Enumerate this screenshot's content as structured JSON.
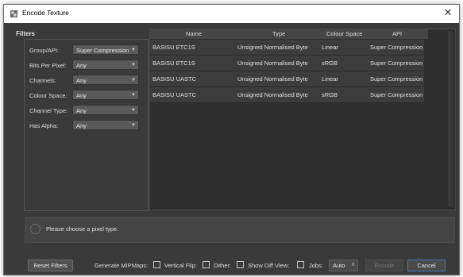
{
  "window": {
    "title": "Encode Texture",
    "close_glyph": "✕"
  },
  "filters": {
    "title": "Filters",
    "rows": [
      {
        "label": "Group/API:",
        "value": "Super Compression"
      },
      {
        "label": "Bits Per Pixel:",
        "value": "Any"
      },
      {
        "label": "Channels:",
        "value": "Any"
      },
      {
        "label": "Colour Space:",
        "value": "Any"
      },
      {
        "label": "Channel Type:",
        "value": "Any"
      },
      {
        "label": "Has Alpha:",
        "value": "Any"
      }
    ]
  },
  "table": {
    "headers": [
      "Name",
      "Type",
      "Colour Space",
      "API"
    ],
    "rows": [
      [
        "BASISU ETC1S",
        "Unsigned Normalised Byte",
        "Linear",
        "Super Compression"
      ],
      [
        "BASISU ETC1S",
        "Unsigned Normalised Byte",
        "sRGB",
        "Super Compression"
      ],
      [
        "BASISU UASTC",
        "Unsigned Normalised Byte",
        "Linear",
        "Super Compression"
      ],
      [
        "BASISU UASTC",
        "Unsigned Normalised Byte",
        "sRGB",
        "Super Compression"
      ]
    ]
  },
  "info": {
    "message": "Please choose a pixel type."
  },
  "bottom": {
    "reset_label": "Reset Filters",
    "mipmaps_label": "Generate MIPMaps:",
    "vflip_label": "Vertical Flip:",
    "dither_label": "Dither:",
    "diff_label": "Show Diff View:",
    "jobs_label": "Jobs:",
    "jobs_value": "Auto",
    "encode_label": "Encode",
    "cancel_label": "Cancel"
  },
  "colors": {
    "background": "#3a3a3a",
    "row": "#3c3c3c",
    "accent": "#3f7bbd"
  },
  "icons": {
    "app": "app-icon",
    "dropdown": "chevron-down-icon",
    "info": "info-icon",
    "spin": "spin-updown-icon"
  }
}
